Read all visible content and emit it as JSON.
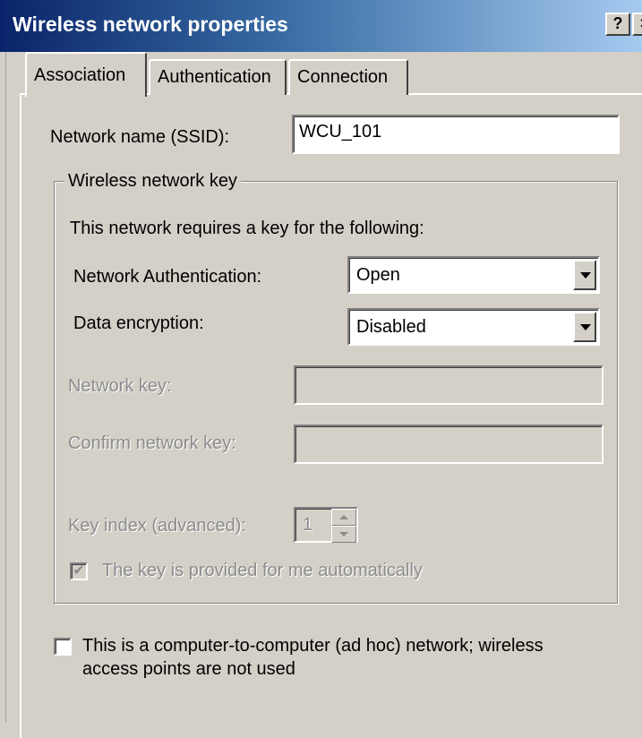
{
  "window": {
    "title": "Wireless network properties",
    "help_button": "?",
    "close_button": "×"
  },
  "tabs": [
    {
      "label": "Association",
      "selected": true
    },
    {
      "label": "Authentication",
      "selected": false
    },
    {
      "label": "Connection",
      "selected": false
    }
  ],
  "association": {
    "ssid_label": "Network name (SSID):",
    "ssid_value": "WCU_101",
    "key_group": {
      "title": "Wireless network key",
      "description": "This network requires a key for the following:",
      "auth_label": "Network Authentication:",
      "auth_value": "Open",
      "encryption_label": "Data encryption:",
      "encryption_value": "Disabled",
      "network_key_label": "Network key:",
      "network_key_value": "",
      "confirm_key_label": "Confirm network key:",
      "confirm_key_value": "",
      "key_index_label": "Key index (advanced):",
      "key_index_value": "1",
      "auto_key_label": "The key is provided for me automatically",
      "auto_key_checked": true
    },
    "adhoc_label_line1": "This is a computer-to-computer (ad hoc) network; wireless",
    "adhoc_label_line2": "access points are not used",
    "adhoc_checked": false
  }
}
